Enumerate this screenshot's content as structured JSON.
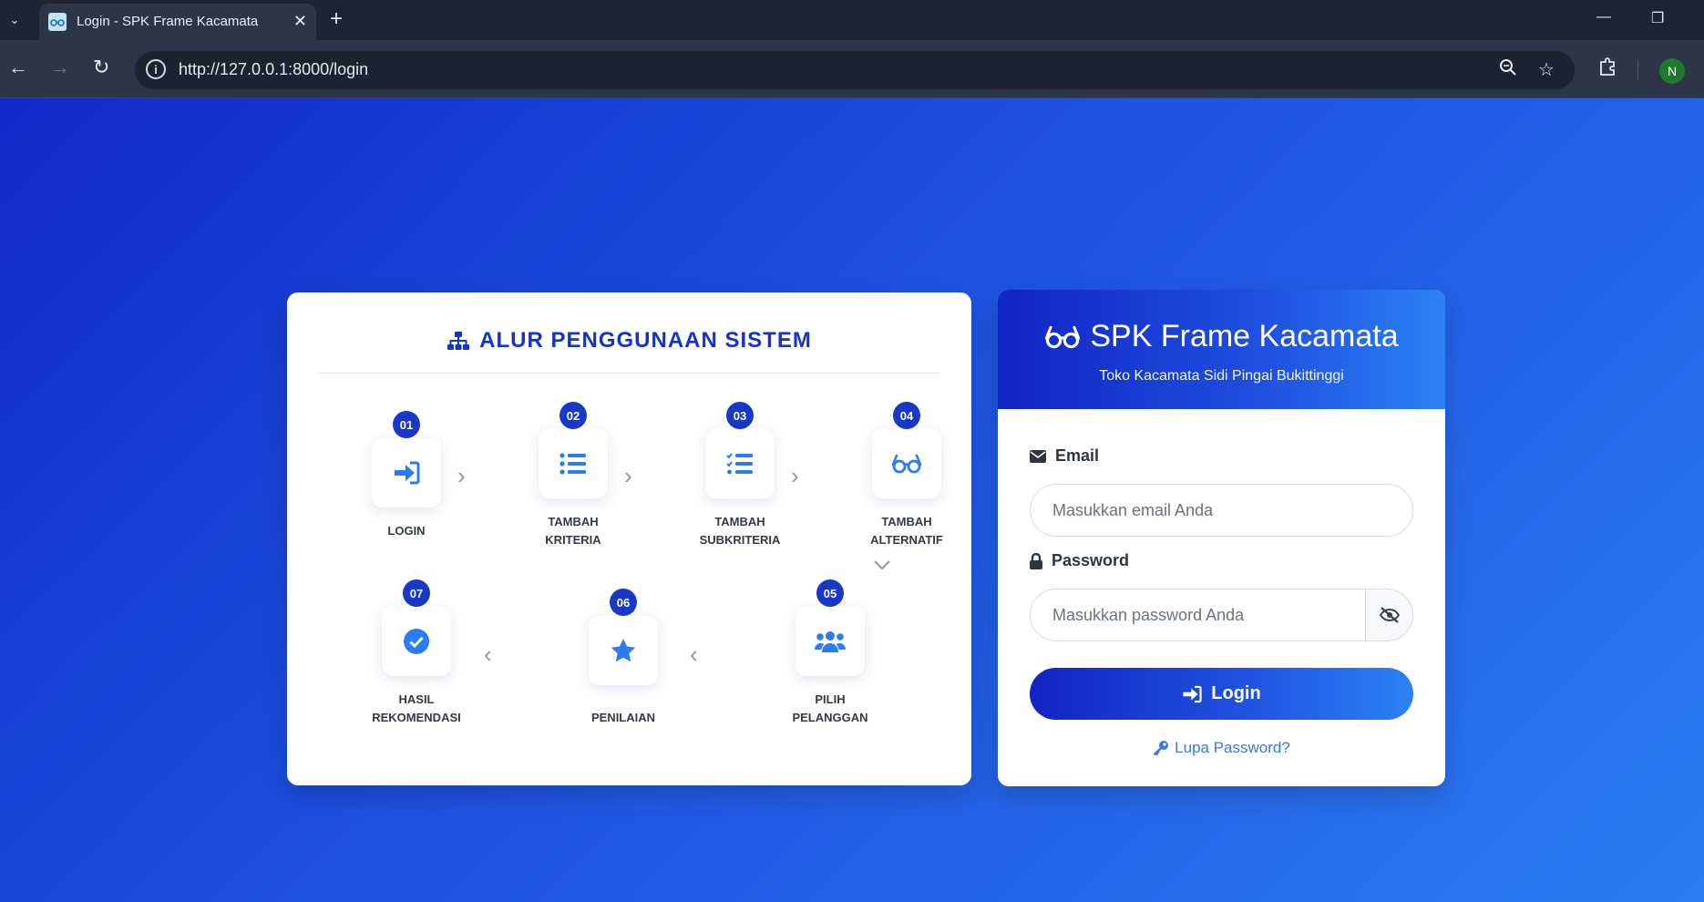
{
  "browser": {
    "tab_title": "Login - SPK Frame Kacamata",
    "url": "http://127.0.0.1:8000/login",
    "profile_initial": "N"
  },
  "flow": {
    "title": "ALUR PENGGUNAAN SISTEM",
    "steps": [
      {
        "num": "01",
        "label1": "LOGIN",
        "label2": "",
        "icon": "sign-in-icon"
      },
      {
        "num": "02",
        "label1": "TAMBAH",
        "label2": "KRITERIA",
        "icon": "list-icon"
      },
      {
        "num": "03",
        "label1": "TAMBAH",
        "label2": "SUBKRITERIA",
        "icon": "list-check-icon"
      },
      {
        "num": "04",
        "label1": "TAMBAH",
        "label2": "ALTERNATIF",
        "icon": "glasses-icon"
      },
      {
        "num": "05",
        "label1": "PILIH",
        "label2": "PELANGGAN",
        "icon": "users-icon"
      },
      {
        "num": "06",
        "label1": "PENILAIAN",
        "label2": "",
        "icon": "star-icon"
      },
      {
        "num": "07",
        "label1": "HASIL",
        "label2": "REKOMENDASI",
        "icon": "check-circle-icon"
      }
    ]
  },
  "login": {
    "brand": "SPK Frame Kacamata",
    "subtitle": "Toko Kacamata Sidi Pingai Bukittinggi",
    "email_label": "Email",
    "email_placeholder": "Masukkan email Anda",
    "password_label": "Password",
    "password_placeholder": "Masukkan password Anda",
    "button_label": "Login",
    "forgot_label": "Lupa Password?"
  },
  "colors": {
    "accent": "#1838c8",
    "icon": "#2b7cf0",
    "gradient_start": "#1229c9",
    "gradient_end": "#2c7cf2"
  }
}
